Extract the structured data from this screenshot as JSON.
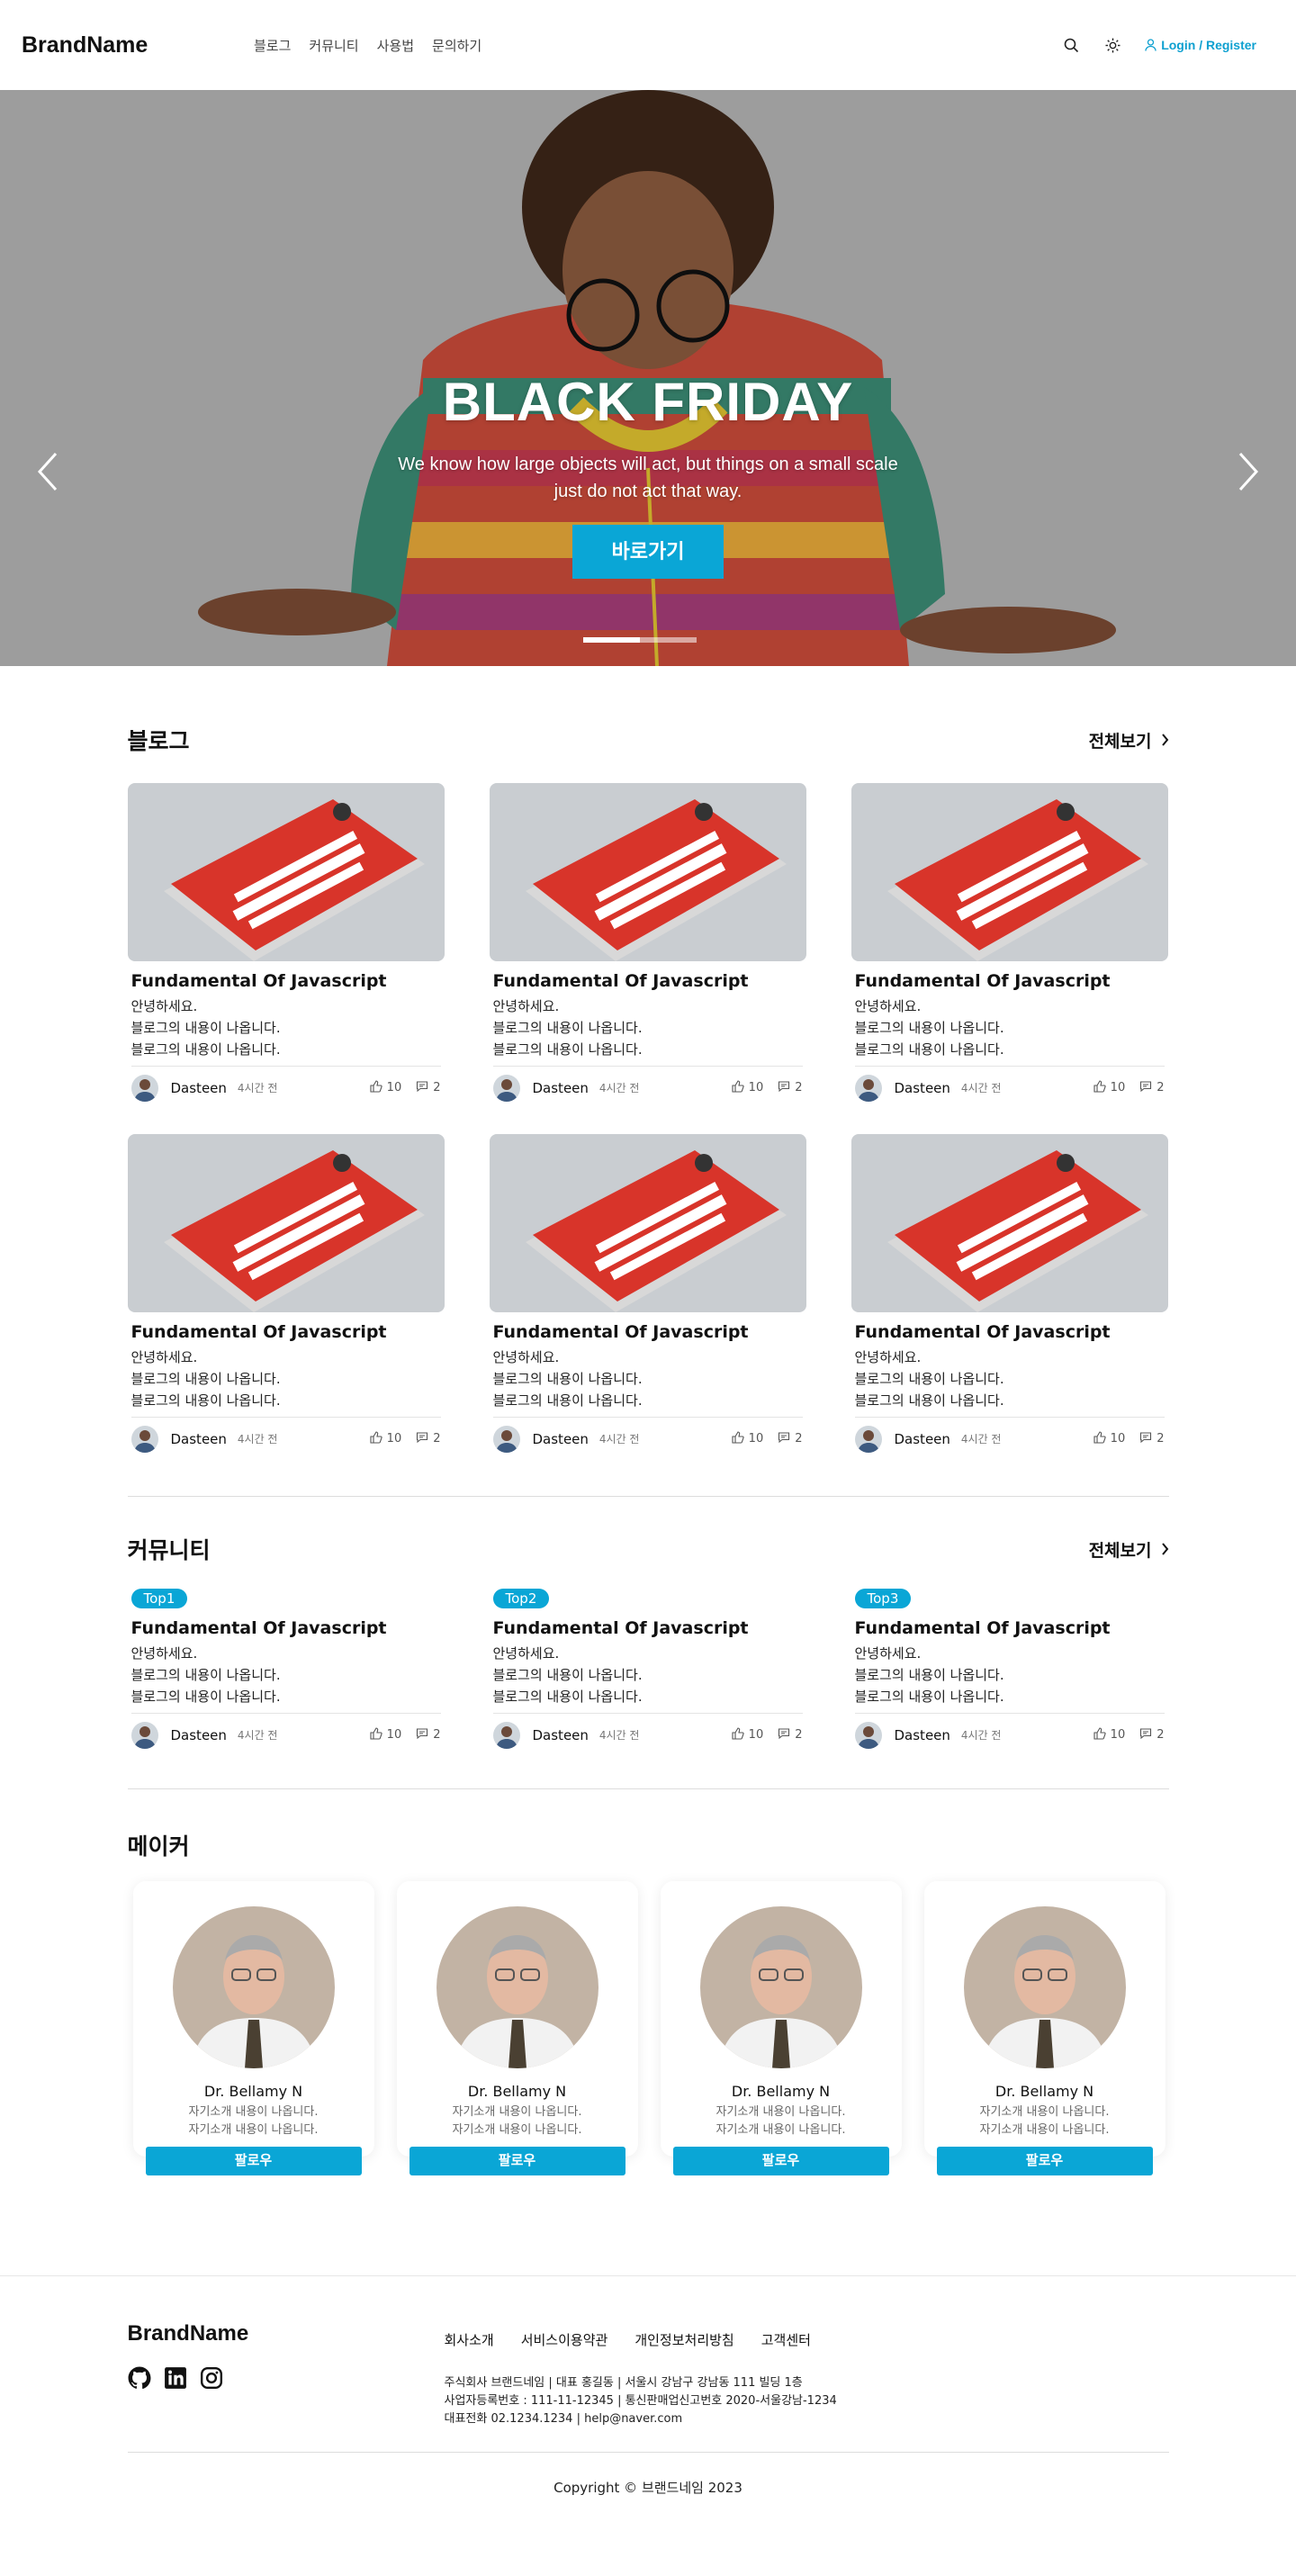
{
  "header": {
    "brand": "BrandName",
    "nav": [
      "블로그",
      "커뮤니티",
      "사용법",
      "문의하기"
    ],
    "login_label": "Login / Register",
    "icons": [
      "search-icon",
      "sun-icon",
      "user-icon"
    ]
  },
  "hero": {
    "title": "BLACK FRIDAY",
    "subtitle": "We know how large objects will act, but things on a small scale just do not act that way.",
    "button_label": "바로가기",
    "slides_total": 2,
    "active_slide": 1
  },
  "blog": {
    "title": "블로그",
    "view_all": "전체보기",
    "cards": [
      {
        "title": "Fundamental Of Javascript",
        "lines": [
          "안녕하세요.",
          "블로그의 내용이 나옵니다.",
          "블로그의 내용이 나옵니다."
        ],
        "author": "Dasteen",
        "time": "4시간 전",
        "likes": "10",
        "comments": "2"
      },
      {
        "title": "Fundamental Of Javascript",
        "lines": [
          "안녕하세요.",
          "블로그의 내용이 나옵니다.",
          "블로그의 내용이 나옵니다."
        ],
        "author": "Dasteen",
        "time": "4시간 전",
        "likes": "10",
        "comments": "2"
      },
      {
        "title": "Fundamental Of Javascript",
        "lines": [
          "안녕하세요.",
          "블로그의 내용이 나옵니다.",
          "블로그의 내용이 나옵니다."
        ],
        "author": "Dasteen",
        "time": "4시간 전",
        "likes": "10",
        "comments": "2"
      },
      {
        "title": "Fundamental Of Javascript",
        "lines": [
          "안녕하세요.",
          "블로그의 내용이 나옵니다.",
          "블로그의 내용이 나옵니다."
        ],
        "author": "Dasteen",
        "time": "4시간 전",
        "likes": "10",
        "comments": "2"
      },
      {
        "title": "Fundamental Of Javascript",
        "lines": [
          "안녕하세요.",
          "블로그의 내용이 나옵니다.",
          "블로그의 내용이 나옵니다."
        ],
        "author": "Dasteen",
        "time": "4시간 전",
        "likes": "10",
        "comments": "2"
      },
      {
        "title": "Fundamental Of Javascript",
        "lines": [
          "안녕하세요.",
          "블로그의 내용이 나옵니다.",
          "블로그의 내용이 나옵니다."
        ],
        "author": "Dasteen",
        "time": "4시간 전",
        "likes": "10",
        "comments": "2"
      }
    ]
  },
  "community": {
    "title": "커뮤니티",
    "view_all": "전체보기",
    "cards": [
      {
        "badge": "Top1",
        "title": "Fundamental Of Javascript",
        "lines": [
          "안녕하세요.",
          "블로그의 내용이 나옵니다.",
          "블로그의 내용이 나옵니다."
        ],
        "author": "Dasteen",
        "time": "4시간 전",
        "likes": "10",
        "comments": "2"
      },
      {
        "badge": "Top2",
        "title": "Fundamental Of Javascript",
        "lines": [
          "안녕하세요.",
          "블로그의 내용이 나옵니다.",
          "블로그의 내용이 나옵니다."
        ],
        "author": "Dasteen",
        "time": "4시간 전",
        "likes": "10",
        "comments": "2"
      },
      {
        "badge": "Top3",
        "title": "Fundamental Of Javascript",
        "lines": [
          "안녕하세요.",
          "블로그의 내용이 나옵니다.",
          "블로그의 내용이 나옵니다."
        ],
        "author": "Dasteen",
        "time": "4시간 전",
        "likes": "10",
        "comments": "2"
      }
    ]
  },
  "makers": {
    "title": "메이커",
    "cards": [
      {
        "name": "Dr. Bellamy N",
        "desc": [
          "자기소개 내용이 나옵니다.",
          "자기소개 내용이 나옵니다."
        ],
        "button": "팔로우"
      },
      {
        "name": "Dr. Bellamy N",
        "desc": [
          "자기소개 내용이 나옵니다.",
          "자기소개 내용이 나옵니다."
        ],
        "button": "팔로우"
      },
      {
        "name": "Dr. Bellamy N",
        "desc": [
          "자기소개 내용이 나옵니다.",
          "자기소개 내용이 나옵니다."
        ],
        "button": "팔로우"
      },
      {
        "name": "Dr. Bellamy N",
        "desc": [
          "자기소개 내용이 나옵니다.",
          "자기소개 내용이 나옵니다."
        ],
        "button": "팔로우"
      }
    ]
  },
  "footer": {
    "brand": "BrandName",
    "links": [
      "회사소개",
      "서비스이용약관",
      "개인정보처리방침",
      "고객센터"
    ],
    "info": [
      "주식회사 브랜드네임 | 대표 홍길동 | 서울시 강남구 강남동 111 빌딩 1층",
      "사업자등록번호 :  111-11-12345 | 통신판매업신고번호 2020-서울강남-1234",
      "대표전화 02.1234.1234 | help@naver.com"
    ],
    "social_icons": [
      "github-icon",
      "linkedin-icon",
      "instagram-icon"
    ],
    "copyright": "Copyright © 브랜드네임 2023"
  },
  "colors": {
    "accent": "#0aa6d6",
    "login": "#0ea0d0"
  }
}
